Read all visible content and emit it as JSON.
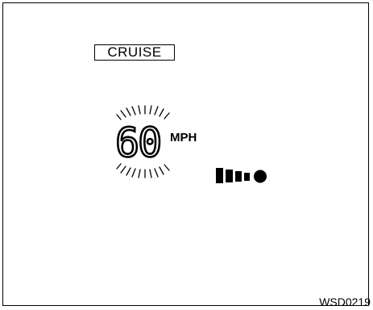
{
  "cruise_label": "CRUISE",
  "speed": {
    "value": "60",
    "unit": "MPH"
  },
  "figure_code": "WSD0219",
  "icons": {
    "flash_rays": "flash-rays-icon",
    "speed_indicator": "speed-indicator-icon"
  },
  "colors": {
    "ink": "#000000",
    "background": "#ffffff"
  }
}
